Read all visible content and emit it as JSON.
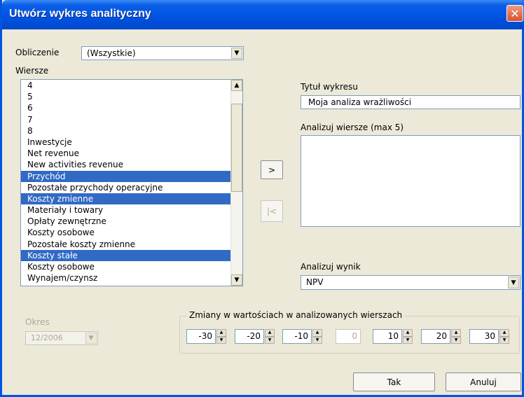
{
  "window": {
    "title": "Utwórz wykres analityczny",
    "close_symbol": "✕"
  },
  "calculation": {
    "label": "Obliczenie",
    "selected": "(Wszystkie)"
  },
  "rows": {
    "label": "Wiersze",
    "items": [
      {
        "text": "4",
        "selected": false
      },
      {
        "text": "5",
        "selected": false
      },
      {
        "text": "6",
        "selected": false
      },
      {
        "text": "7",
        "selected": false
      },
      {
        "text": "8",
        "selected": false
      },
      {
        "text": "Inwestycje",
        "selected": false
      },
      {
        "text": "Net revenue",
        "selected": false
      },
      {
        "text": "New activities revenue",
        "selected": false
      },
      {
        "text": "Przychód",
        "selected": true
      },
      {
        "text": "Pozostałe przychody operacyjne",
        "selected": false
      },
      {
        "text": "Koszty zmienne",
        "selected": true
      },
      {
        "text": "Materiały i towary",
        "selected": false
      },
      {
        "text": "Opłaty zewnętrzne",
        "selected": false
      },
      {
        "text": "Koszty osobowe",
        "selected": false
      },
      {
        "text": "Pozostałe koszty zmienne",
        "selected": false
      },
      {
        "text": "Koszty stałe",
        "selected": true
      },
      {
        "text": "Koszty osobowe",
        "selected": false
      },
      {
        "text": "Wynajem/czynsz",
        "selected": false
      }
    ]
  },
  "buttons": {
    "add": ">",
    "remove": "|<",
    "ok": "Tak",
    "cancel": "Anuluj"
  },
  "chart_title": {
    "label": "Tytuł wykresu",
    "value": "Moja analiza wrażliwości"
  },
  "analyze_rows": {
    "label": "Analizuj wiersze (max 5)",
    "items": []
  },
  "analyze_result": {
    "label": "Analizuj wynik",
    "selected": "NPV"
  },
  "period": {
    "label": "Okres",
    "selected": "12/2006",
    "enabled": false
  },
  "changes": {
    "label": "Zmiany w wartościach w analizowanych wierszach",
    "values": [
      "-30",
      "-20",
      "-10",
      "0",
      "10",
      "20",
      "30"
    ]
  }
}
